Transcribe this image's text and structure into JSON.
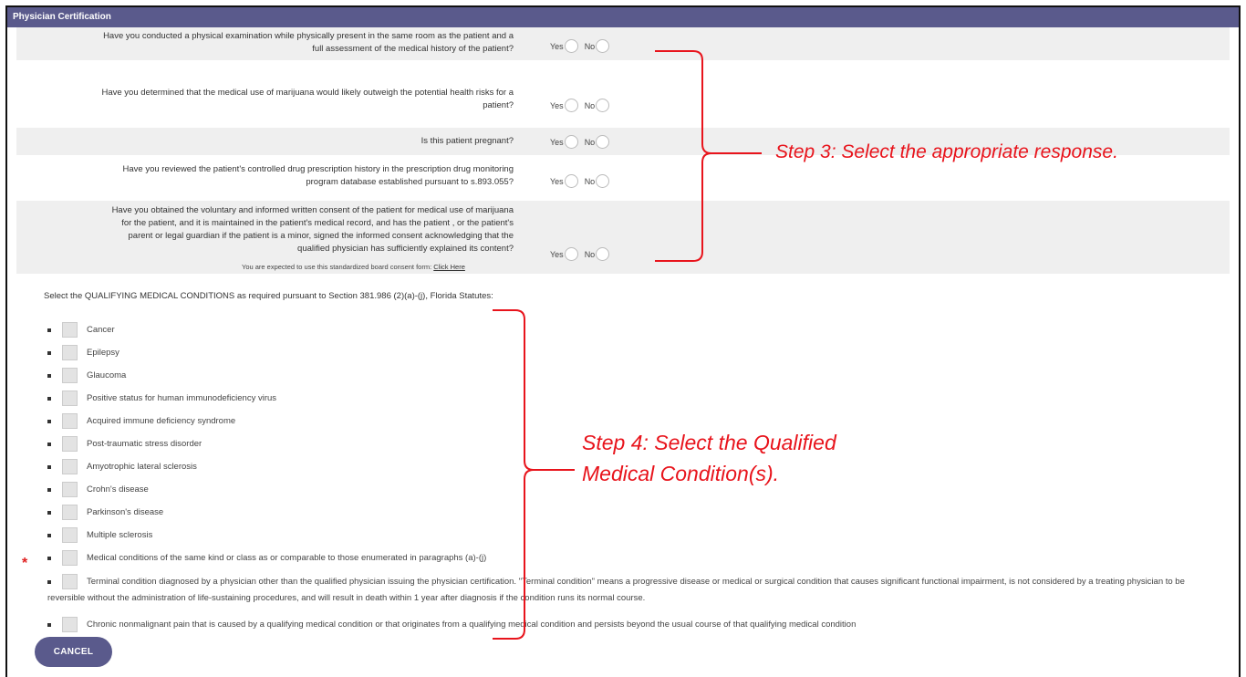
{
  "header": {
    "title": "Physician Certification"
  },
  "questions": [
    {
      "text_line1": "Have you conducted a physical examination while physically present in the same room as the patient and a",
      "text_line2": "full assessment of the medical history of the patient?",
      "yes": "Yes",
      "no": "No"
    },
    {
      "text_line1": "Have you determined that the medical use of marijuana would likely outweigh the potential health risks for a",
      "text_line2": "patient?",
      "yes": "Yes",
      "no": "No"
    },
    {
      "text_line1": "Is this patient pregnant?",
      "yes": "Yes",
      "no": "No"
    },
    {
      "text_line1": "Have you reviewed the patient's controlled drug prescription history in the prescription drug monitoring",
      "text_line2": "program database established pursuant to s.893.055?",
      "yes": "Yes",
      "no": "No"
    },
    {
      "text_line1": "Have you obtained the voluntary and informed written consent of the patient for medical use of marijuana",
      "text_line2": "for the patient, and it is maintained in the patient's medical record, and has the patient , or the patient's",
      "text_line3": "parent or legal guardian if the patient is a minor, signed the informed consent acknowledging that the",
      "text_line4": "qualified physician has sufficiently explained its content?",
      "yes": "Yes",
      "no": "No"
    }
  ],
  "consent_note": {
    "text": "You are expected to use this standardized board consent form:",
    "link": "Click Here"
  },
  "conditions_heading": "Select the QUALIFYING MEDICAL CONDITIONS as required pursuant to Section 381.986 (2)(a)-(j), Florida Statutes:",
  "conditions": [
    "Cancer",
    "Epilepsy",
    "Glaucoma",
    "Positive status for human immunodeficiency virus",
    "Acquired immune deficiency syndrome",
    "Post-traumatic stress disorder",
    "Amyotrophic lateral sclerosis",
    "Crohn's disease",
    "Parkinson's disease",
    "Multiple sclerosis",
    "Medical conditions of the same kind or class as or comparable to those enumerated in paragraphs (a)-(j)"
  ],
  "terminal_condition": "Terminal condition diagnosed by a physician other than the qualified physician issuing the physician certification. \"Terminal condition\" means a progressive disease or medical or surgical condition that causes significant functional impairment, is not considered by a treating physician to be reversible without the administration of life-sustaining procedures, and will result in death within 1 year after diagnosis if the condition runs its normal course.",
  "chronic_pain": "Chronic nonmalignant pain that is caused by a qualifying medical condition or that originates from a qualifying medical condition and persists beyond the usual course of that qualifying medical condition",
  "required_marker": "*",
  "cancel_label": "CANCEL",
  "annotations": {
    "step3": "Step 3: Select the appropriate response.",
    "step4_line1": "Step 4: Select the Qualified",
    "step4_line2": "Medical Condition(s)."
  },
  "colors": {
    "header_bg": "#5a5a8c",
    "annotation_red": "#e8141c",
    "row_shade": "#efefef"
  }
}
